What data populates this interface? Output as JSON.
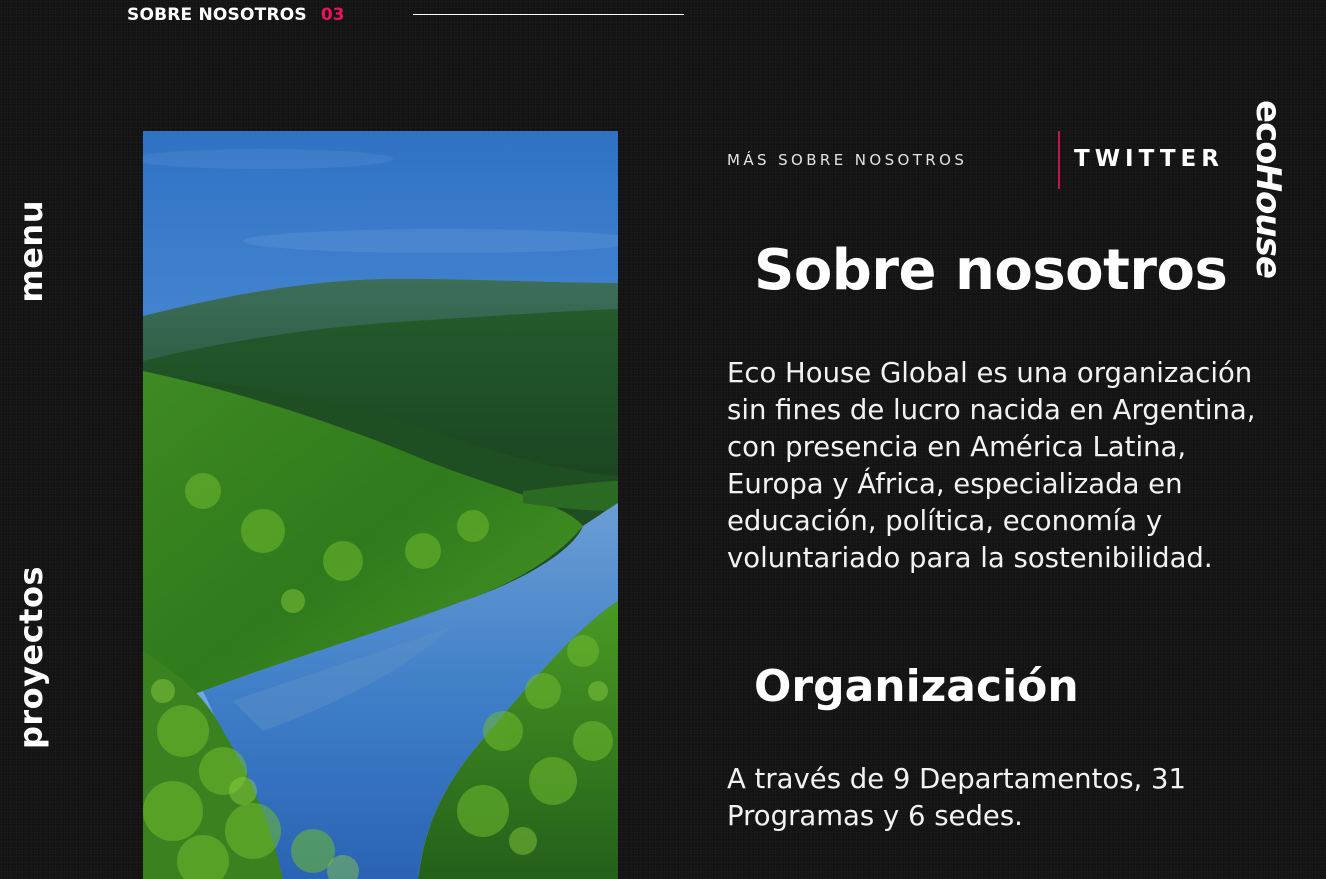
{
  "header": {
    "section_label": "SOBRE NOSOTROS",
    "section_number": "03"
  },
  "sidebar": {
    "menu_label": "menu",
    "projects_label": "proyectos"
  },
  "top_links": {
    "more_about": "MÁS SOBRE NOSOTROS",
    "twitter": "TWITTER",
    "accent_color": "#c2124f"
  },
  "brand": {
    "part1": "eco",
    "part2": "House"
  },
  "main": {
    "title": "Sobre nosotros",
    "description": "Eco House Global es una organización sin fines de lucro nacida en Argentina, con presencia en América Latina, Europa y África, especializada en educación, política, economía y voluntariado para la sostenibilidad.",
    "org_title": "Organización",
    "org_description": "A través de 9 Departamentos, 31 Programas y 6 sedes."
  },
  "image": {
    "subject": "river valley landscape"
  }
}
